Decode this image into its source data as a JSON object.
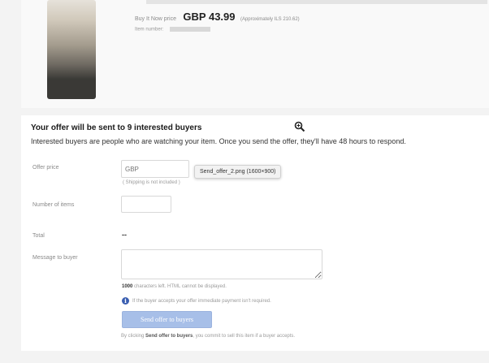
{
  "listing": {
    "price_label": "Buy It Now price",
    "price_value": "GBP 43.99",
    "price_approx": "(Approximately ILS 210.62)",
    "item_number_label": "Item number:"
  },
  "offer_form": {
    "title": "Your offer will be sent to 9 interested buyers",
    "subtitle": "Interested buyers are people who are watching your item. Once you send the offer, they'll have 48 hours to respond.",
    "offer_price_label": "Offer price",
    "offer_price_placeholder": "GBP",
    "shipping_note": "( Shipping is not included )",
    "tooltip": "Send_offer_2.png (1600×900)",
    "number_of_items_label": "Number of items",
    "total_label": "Total",
    "total_value": "--",
    "message_label": "Message to buyer",
    "chars_left_count": "1000",
    "chars_left_text": "characters left. HTML cannot be displayed.",
    "info_text": "If the buyer accepts your offer immediate payment isn't required.",
    "send_button": "Send offer to buyers",
    "consent_prefix": "By clicking",
    "consent_bold": "Send offer to buyers",
    "consent_suffix": ", you commit to sell this item if a buyer accepts."
  },
  "colors": {
    "button_bg": "#a7bfe8",
    "info_icon": "#3a5eb1"
  },
  "icons": {
    "zoom": "zoom-in-icon",
    "info": "info-icon"
  }
}
